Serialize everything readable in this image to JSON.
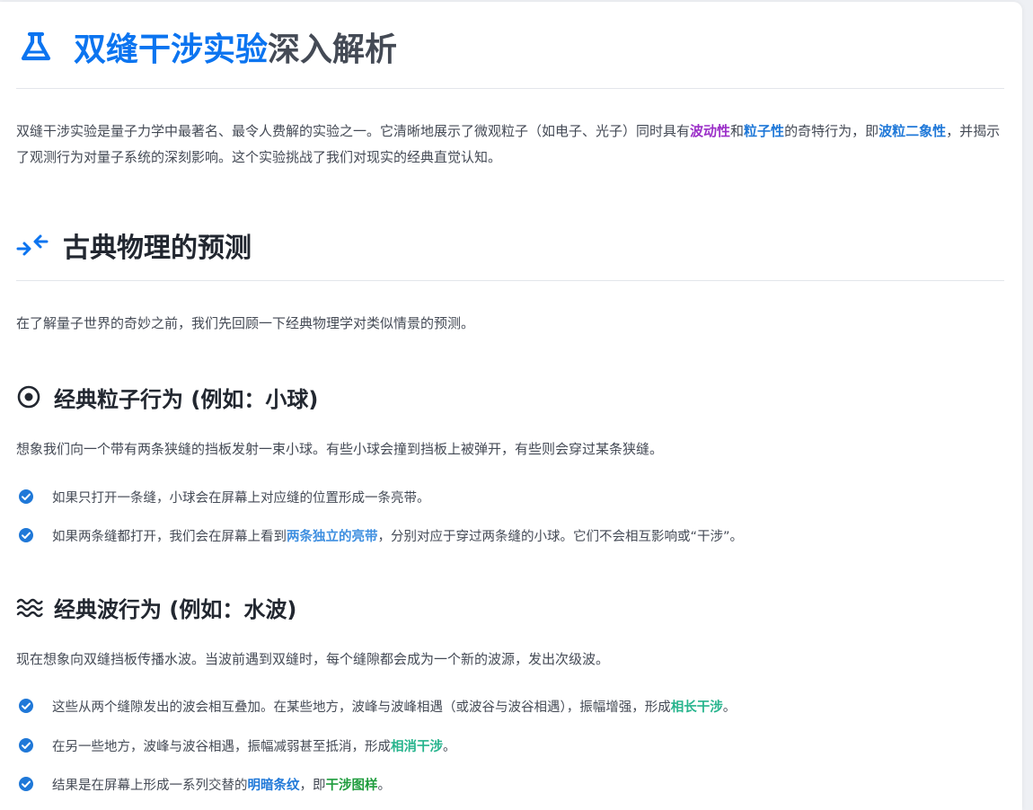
{
  "title": {
    "accent": "双缝干涉实验",
    "rest": "深入解析"
  },
  "intro": {
    "t1": "双缝干涉实验是量子力学中最著名、最令人费解的实验之一。它清晰地展示了微观粒子（如电子、光子）同时具有",
    "wave": "波动性",
    "and": "和",
    "particle": "粒子性",
    "t2": "的奇特行为，即",
    "duality": "波粒二象性",
    "t3": "，并揭示了观测行为对量子系统的深刻影响。这个实验挑战了我们对现实的经典直觉认知。"
  },
  "section_classical": {
    "title": "古典物理的预测",
    "lead": "在了解量子世界的奇妙之前，我们先回顾一下经典物理学对类似情景的预测。"
  },
  "particles": {
    "title": "经典粒子行为 (例如：小球)",
    "lead": "想象我们向一个带有两条狭缝的挡板发射一束小球。有些小球会撞到挡板上被弹开，有些则会穿过某条狭缝。",
    "item1": "如果只打开一条缝，小球会在屏幕上对应缝的位置形成一条亮带。",
    "item2": {
      "pre": "如果两条缝都打开，我们会在屏幕上看到",
      "bold": "两条独立的亮带",
      "post": "，分别对应于穿过两条缝的小球。它们不会相互影响或“干涉”。"
    }
  },
  "waves": {
    "title": "经典波行为 (例如：水波)",
    "lead": "现在想象向双缝挡板传播水波。当波前遇到双缝时，每个缝隙都会成为一个新的波源，发出次级波。",
    "item1": {
      "pre": "这些从两个缝隙发出的波会相互叠加。在某些地方，波峰与波峰相遇（或波谷与波谷相遇），振幅增强，形成",
      "bold": "相长干涉",
      "post": "。"
    },
    "item2": {
      "pre": "在另一些地方，波峰与波谷相遇，振幅减弱甚至抵消，形成",
      "bold": "相消干涉",
      "post": "。"
    },
    "item3": {
      "pre": "结果是在屏幕上形成一系列交替的",
      "bold1": "明暗条纹",
      "mid": "，即",
      "bold2": "干涉图样",
      "post": "。"
    }
  },
  "colors": {
    "accent_blue": "#0b74f0",
    "purple": "#9b2fc8",
    "teal": "#27b48d",
    "green": "#1f9c3d"
  },
  "icons": [
    "flask-icon",
    "arrows-compress-icon",
    "dot-circle-icon",
    "water-icon",
    "check-circle-icon"
  ]
}
